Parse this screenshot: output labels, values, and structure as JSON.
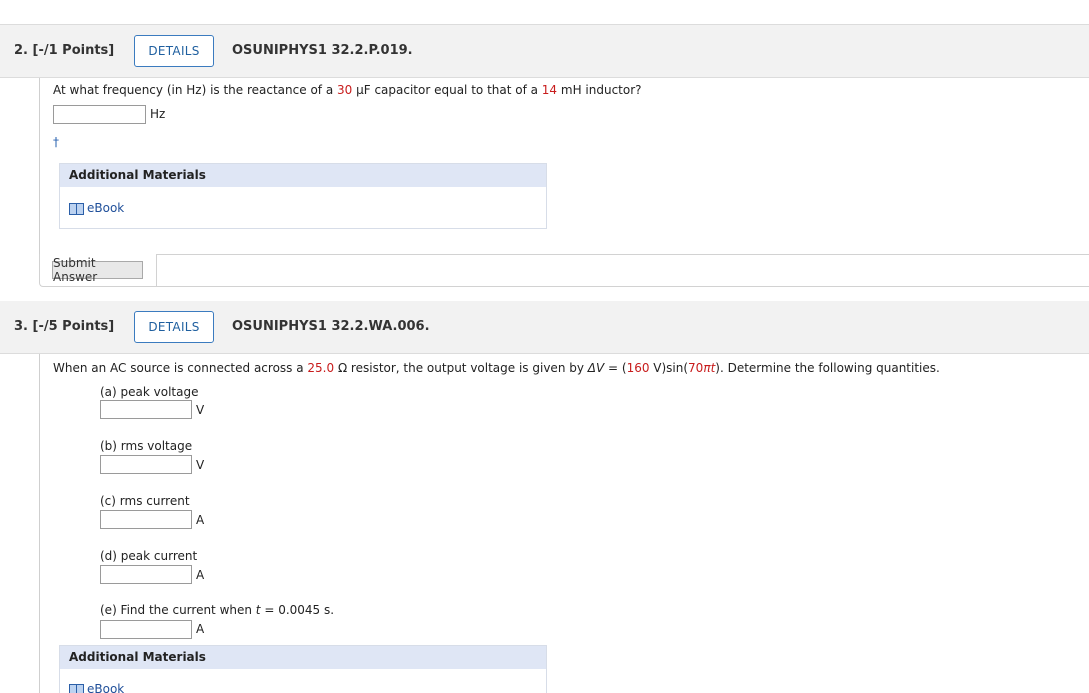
{
  "q2": {
    "number": "2.  [-/1 Points]",
    "details_label": "DETAILS",
    "code": "OSUNIPHYS1 32.2.P.019.",
    "prompt": {
      "p1": "At what frequency (in Hz) is the reactance of a ",
      "v1": "30",
      "p2": " μF capacitor equal to that of a ",
      "v2": "14",
      "p3": " mH inductor?"
    },
    "answer_value": "",
    "unit": "Hz",
    "dagger": "†",
    "additional_materials": "Additional Materials",
    "ebook": "eBook",
    "submit_label": "Submit Answer"
  },
  "q3": {
    "number": "3.  [-/5 Points]",
    "details_label": "DETAILS",
    "code": "OSUNIPHYS1 32.2.WA.006.",
    "prompt": {
      "p1": "When an AC source is connected across a ",
      "v1": "25.0",
      "p2": " Ω resistor, the output voltage is given by ",
      "dv": "ΔV",
      "p3": " = (",
      "v2": "160",
      "p4": " V)sin(",
      "v3": "70",
      "p5": "π",
      "t": "t",
      "p6": "). Determine the following quantities."
    },
    "parts": [
      {
        "label": "(a) peak voltage",
        "unit": "V",
        "value": ""
      },
      {
        "label": "(b) rms voltage",
        "unit": "V",
        "value": ""
      },
      {
        "label": "(c) rms current",
        "unit": "A",
        "value": ""
      },
      {
        "label": "(d) peak current",
        "unit": "A",
        "value": ""
      },
      {
        "label_pre": "(e) Find the current when ",
        "label_t": "t",
        "label_post": " = 0.0045 s.",
        "unit": "A",
        "value": ""
      }
    ],
    "additional_materials": "Additional Materials",
    "ebook": "eBook"
  }
}
